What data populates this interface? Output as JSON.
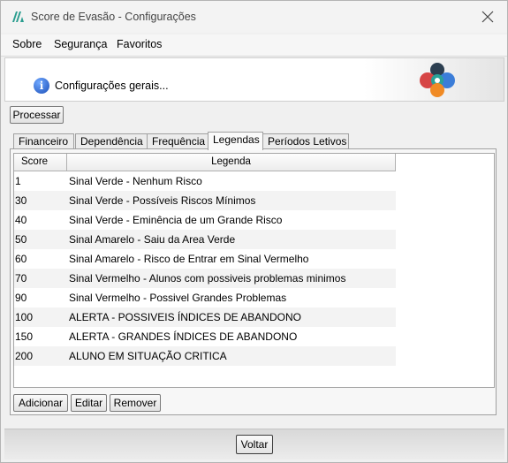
{
  "window": {
    "title": "Score de Evasão - Configurações"
  },
  "menu": {
    "items": [
      "Sobre",
      "Segurança",
      "Favoritos"
    ]
  },
  "banner": {
    "text": "Configurações gerais..."
  },
  "toolbar": {
    "process_label": "Processar"
  },
  "tabs": [
    {
      "label": "Financeiro",
      "active": false
    },
    {
      "label": "Dependência",
      "active": false
    },
    {
      "label": "Frequência",
      "active": false
    },
    {
      "label": "Legendas",
      "active": true
    },
    {
      "label": "Períodos Letivos",
      "active": false
    }
  ],
  "table": {
    "columns": [
      "Score",
      "Legenda"
    ],
    "rows": [
      {
        "score": "1",
        "legenda": "Sinal Verde - Nenhum Risco"
      },
      {
        "score": "30",
        "legenda": "Sinal Verde - Possíveis Riscos Mínimos"
      },
      {
        "score": "40",
        "legenda": "Sinal Verde - Eminência de um Grande Risco"
      },
      {
        "score": "50",
        "legenda": "Sinal Amarelo - Saiu da Area Verde"
      },
      {
        "score": "60",
        "legenda": "Sinal Amarelo - Risco de Entrar em Sinal Vermelho"
      },
      {
        "score": "70",
        "legenda": "Sinal Vermelho - Alunos com possiveis problemas minimos"
      },
      {
        "score": "90",
        "legenda": "Sinal Vermelho -  Possivel Grandes Problemas"
      },
      {
        "score": "100",
        "legenda": "ALERTA - POSSIVEIS ÍNDICES DE ABANDONO"
      },
      {
        "score": "150",
        "legenda": "ALERTA - GRANDES ÍNDICES DE ABANDONO"
      },
      {
        "score": "200",
        "legenda": "ALUNO EM SITUAÇÃO CRITICA"
      }
    ]
  },
  "actions": {
    "add_label": "Adicionar",
    "edit_label": "Editar",
    "remove_label": "Remover"
  },
  "footer": {
    "back_label": "Voltar"
  },
  "icons": {
    "app": "app-logo-icon",
    "close": "close-icon",
    "info": "info-icon",
    "logo": "company-logo"
  },
  "colors": {
    "info_blue": "#1c4fb8",
    "logo_red": "#d64545",
    "logo_teal": "#2aa198",
    "logo_orange": "#f08a24",
    "logo_blue": "#3b7dd8"
  }
}
